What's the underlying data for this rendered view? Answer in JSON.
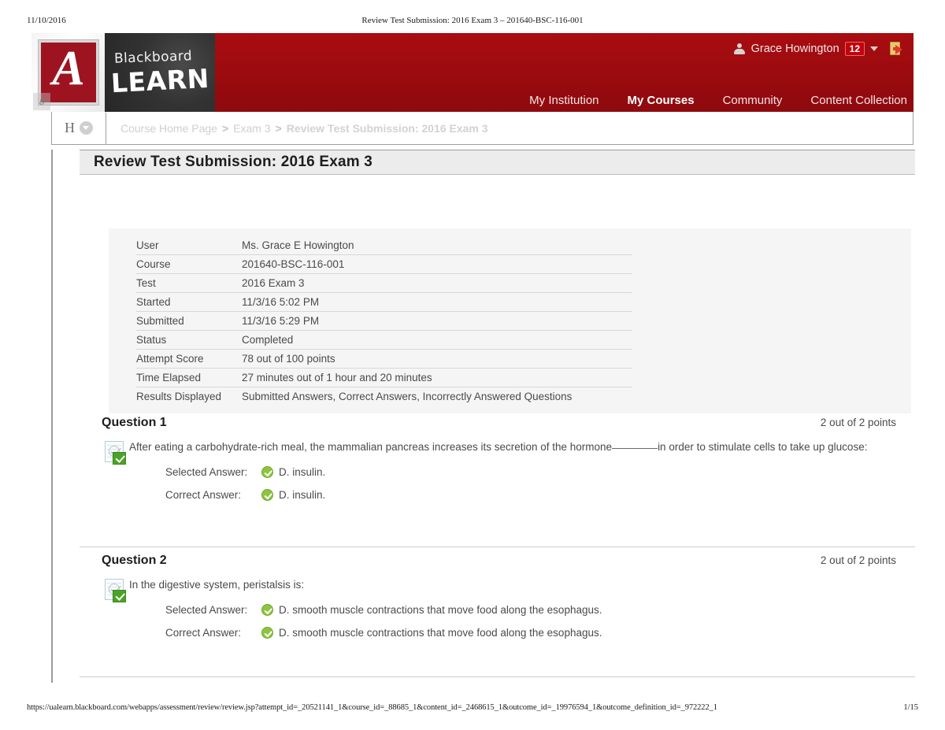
{
  "print": {
    "date": "11/10/2016",
    "title": "Review Test Submission: 2016 Exam 3 – 201640-BSC-116-001",
    "url": "https://ualearn.blackboard.com/webapps/assessment/review/review.jsp?attempt_id=_20521141_1&course_id=_88685_1&content_id=_2468615_1&outcome_id=_19976594_1&outcome_definition_id=_972222_1",
    "page": "1/15"
  },
  "brand": {
    "institution_letter": "A",
    "product_line1": "Blackboard",
    "product_line2": "LEARN",
    "corner_mark": "8",
    "red": "#9d0b0f",
    "crimson": "#9d1420"
  },
  "user_strip": {
    "name": "Grace Howington",
    "notification_count": "12"
  },
  "mainnav": {
    "items": [
      {
        "label": "My Institution",
        "active": false
      },
      {
        "label": "My Courses",
        "active": true
      },
      {
        "label": "Community",
        "active": false
      },
      {
        "label": "Content Collection",
        "active": false
      }
    ]
  },
  "breadcrumb": {
    "course_letter": "H",
    "items": [
      "Course Home Page",
      "Exam 3",
      "Review Test Submission: 2016 Exam 3"
    ],
    "separator": ">"
  },
  "page": {
    "title": "Review Test Submission: 2016 Exam 3"
  },
  "attempt_info": {
    "rows": [
      {
        "label": "User",
        "value": "Ms. Grace E Howington"
      },
      {
        "label": "Course",
        "value": "201640-BSC-116-001"
      },
      {
        "label": "Test",
        "value": "2016 Exam 3"
      },
      {
        "label": "Started",
        "value": "11/3/16 5:02 PM"
      },
      {
        "label": "Submitted",
        "value": "11/3/16 5:29 PM"
      },
      {
        "label": "Status",
        "value": "Completed"
      },
      {
        "label": "Attempt Score",
        "value": "78 out of 100 points"
      },
      {
        "label": "Time Elapsed",
        "value": "27 minutes out of 1 hour and 20 minutes"
      },
      {
        "label": "Results Displayed",
        "value": "Submitted Answers, Correct Answers, Incorrectly Answered Questions"
      }
    ]
  },
  "questions": [
    {
      "title": "Question 1",
      "points": "2 out of 2 points",
      "text_before_blank": "After eating a carbohydrate-rich meal, the mammalian pancreas increases its secretion of the hormone",
      "text_after_blank": "in order to stimulate cells to take up glucose:",
      "selected_label": "Selected Answer:",
      "selected_value": "D. insulin.",
      "correct_label": "Correct Answer:",
      "correct_value": "D. insulin."
    },
    {
      "title": "Question 2",
      "points": "2 out of 2 points",
      "text": "In the digestive system, peristalsis is:",
      "selected_label": "Selected Answer:",
      "selected_value": "D. smooth muscle contractions that move food along the esophagus.",
      "correct_label": "Correct Answer:",
      "correct_value": "D. smooth muscle contractions that move food along the esophagus."
    }
  ]
}
